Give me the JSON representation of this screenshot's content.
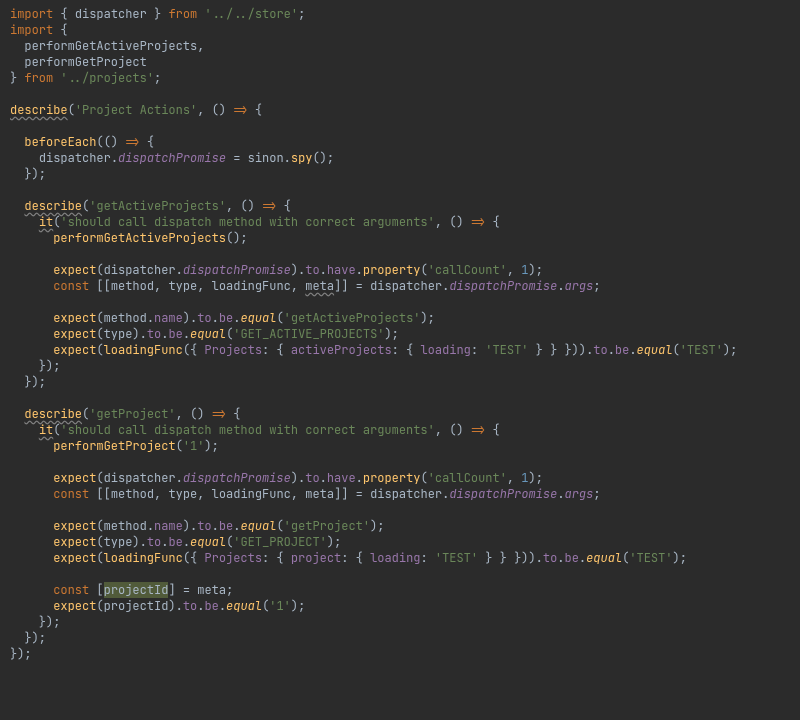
{
  "code": {
    "imports": {
      "dispatcher": "dispatcher",
      "storePath": "'../../store'",
      "performGetActiveProjects": "performGetActiveProjects",
      "performGetProject": "performGetProject",
      "projectsPath": "'../projects'"
    },
    "keywords": {
      "import": "import",
      "from": "from",
      "const": "const"
    },
    "fns": {
      "describe": "describe",
      "beforeEach": "beforeEach",
      "it": "it",
      "spy": "spy",
      "expect": "expect",
      "property": "property",
      "equal": "equal",
      "performGetActiveProjects": "performGetActiveProjects",
      "performGetProject": "performGetProject"
    },
    "idents": {
      "dispatcher": "dispatcher",
      "sinon": "sinon",
      "method": "method",
      "type": "type",
      "loadingFunc": "loadingFunc",
      "meta": "meta",
      "projectId": "projectId"
    },
    "props": {
      "dispatchPromise": "dispatchPromise",
      "to": "to",
      "have": "have",
      "be": "be",
      "args": "args",
      "name": "name",
      "Projects": "Projects",
      "activeProjects": "activeProjects",
      "project": "project",
      "loading": "loading"
    },
    "strings": {
      "projectActions": "'Project Actions'",
      "getActiveProjects": "'getActiveProjects'",
      "getProject": "'getProject'",
      "shouldCall": "'should call dispatch method with correct arguments'",
      "callCount": "'callCount'",
      "GET_ACTIVE_PROJECTS": "'GET_ACTIVE_PROJECTS'",
      "GET_PROJECT": "'GET_PROJECT'",
      "TEST": "'TEST'",
      "one": "'1'"
    },
    "nums": {
      "one": "1"
    },
    "punct": {
      "lbrace": "{",
      "rbrace": "}",
      "lparen": "(",
      "rparen": ")",
      "lbr": "[",
      "rbr": "]",
      "comma": ",",
      "semi": ";",
      "arrow": "=>",
      "eq": "=",
      "dot": "."
    }
  }
}
